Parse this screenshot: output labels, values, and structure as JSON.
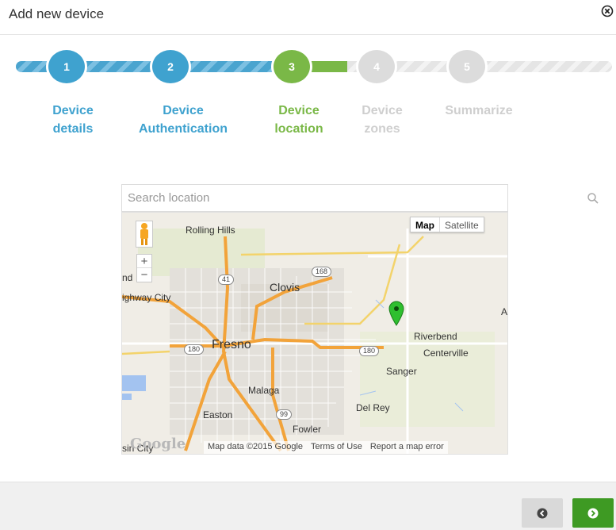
{
  "dialog": {
    "title": "Add new device"
  },
  "wizard": {
    "steps": [
      {
        "number": "1",
        "line1": "Device",
        "line2": "details",
        "state": "done"
      },
      {
        "number": "2",
        "line1": "Device",
        "line2": "Authentication",
        "state": "done"
      },
      {
        "number": "3",
        "line1": "Device",
        "line2": "location",
        "state": "active"
      },
      {
        "number": "4",
        "line1": "Device",
        "line2": "zones",
        "state": "pending"
      },
      {
        "number": "5",
        "line1": "Summarize",
        "line2": "",
        "state": "pending"
      }
    ]
  },
  "search": {
    "placeholder": "Search location"
  },
  "map": {
    "map_type_map": "Map",
    "map_type_satellite": "Satellite",
    "zoom_in": "+",
    "zoom_out": "−",
    "places": {
      "rolling_hills": "Rolling Hills",
      "clovis": "Clovis",
      "fresno": "Fresno",
      "highway_city": "ighway City",
      "nd": "nd",
      "riverbend": "Riverbend",
      "centerville": "Centerville",
      "sanger": "Sanger",
      "malaga": "Malaga",
      "easton": "Easton",
      "del_rey": "Del Rey",
      "fowler": "Fowler",
      "sin_city": "sin City",
      "a_edge": "A"
    },
    "routes": {
      "r41": "41",
      "r168": "168",
      "r180w": "180",
      "r180e": "180",
      "r99": "99"
    },
    "logo": "Google",
    "attribution": {
      "data": "Map data ©2015 Google",
      "terms": "Terms of Use",
      "report": "Report a map error"
    }
  },
  "colors": {
    "done": "#3fa2cf",
    "active": "#7ab847",
    "pending": "#dcdcdc",
    "next_button": "#3e9a23",
    "highway": "#f2a33a"
  }
}
